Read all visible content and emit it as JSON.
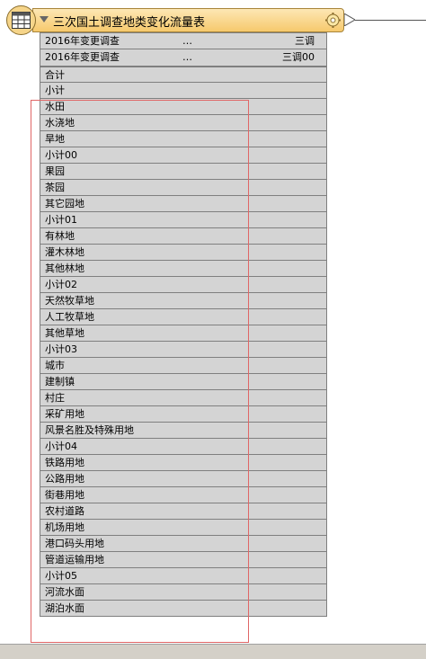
{
  "transformer": {
    "title": "三次国土调查地类变化流量表"
  },
  "attributes": [
    {
      "name": "2016年变更调查",
      "value": "…",
      "type": "三调"
    },
    {
      "name": "2016年变更调查",
      "value": "…",
      "type": "三调00"
    }
  ],
  "rows": [
    "合计",
    "小计",
    "水田",
    "水浇地",
    "旱地",
    "小计00",
    "果园",
    "茶园",
    "其它园地",
    "小计01",
    "有林地",
    "灌木林地",
    "其他林地",
    "小计02",
    "天然牧草地",
    "人工牧草地",
    "其他草地",
    "小计03",
    "城市",
    "建制镇",
    "村庄",
    "采矿用地",
    "风景名胜及特殊用地",
    "小计04",
    "铁路用地",
    "公路用地",
    "街巷用地",
    "农村道路",
    "机场用地",
    "港口码头用地",
    "管道运输用地",
    "小计05",
    "河流水面",
    "湖泊水面"
  ],
  "colors": {
    "header_bg": "#f6c96d",
    "row_bg": "#d4d4d4",
    "highlight_border": "#e06666"
  }
}
